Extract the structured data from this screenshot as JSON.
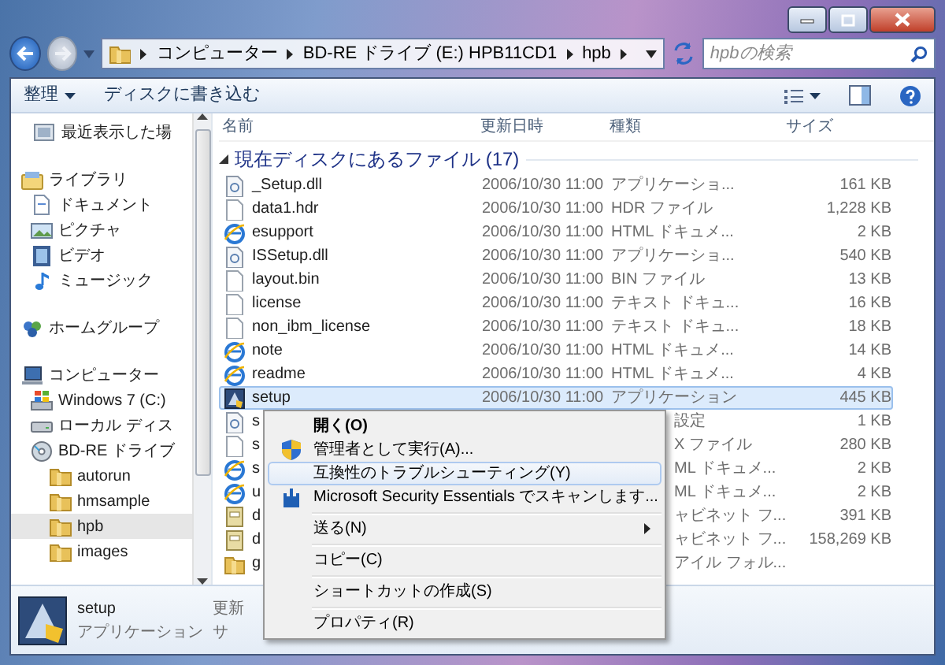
{
  "window": {
    "controls": [
      {
        "kind": "minimize"
      },
      {
        "kind": "maximize"
      },
      {
        "kind": "close"
      }
    ]
  },
  "address": {
    "segments": [
      "コンピューター",
      "BD-RE ドライブ (E:) HPB11CD1",
      "hpb"
    ]
  },
  "search": {
    "placeholder": "hpbの検索"
  },
  "toolbar": {
    "buttons": [
      {
        "label": "整理",
        "dropdown": true
      },
      {
        "label": "ディスクに書き込む",
        "dropdown": false
      }
    ]
  },
  "nav": {
    "sections": [
      {
        "items": [
          {
            "label": "最近表示した場",
            "kind": "recent",
            "selected": false
          }
        ]
      },
      {
        "items": [
          {
            "label": "ライブラリ",
            "kind": "library",
            "selected": false,
            "children": [
              {
                "label": "ドキュメント",
                "kind": "document",
                "selected": false
              },
              {
                "label": "ピクチャ",
                "kind": "picture",
                "selected": false
              },
              {
                "label": "ビデオ",
                "kind": "video",
                "selected": false
              },
              {
                "label": "ミュージック",
                "kind": "music",
                "selected": false
              }
            ]
          }
        ]
      },
      {
        "items": [
          {
            "label": "ホームグループ",
            "kind": "homegroup",
            "selected": false
          }
        ]
      },
      {
        "items": [
          {
            "label": "コンピューター",
            "kind": "computer",
            "selected": false,
            "children": [
              {
                "label": "Windows 7 (C:)",
                "kind": "windrive",
                "selected": false
              },
              {
                "label": "ローカル ディス",
                "kind": "disk",
                "selected": false
              },
              {
                "label": "BD-RE ドライブ",
                "kind": "bddrive",
                "selected": false,
                "children": [
                  {
                    "label": "autorun",
                    "kind": "folder",
                    "selected": false
                  },
                  {
                    "label": "hmsample",
                    "kind": "folder",
                    "selected": false
                  },
                  {
                    "label": "hpb",
                    "kind": "folder",
                    "selected": true
                  },
                  {
                    "label": "images",
                    "kind": "folder",
                    "selected": false
                  }
                ]
              }
            ]
          }
        ]
      }
    ]
  },
  "columns": [
    "名前",
    "更新日時",
    "種類",
    "サイズ"
  ],
  "group": {
    "title": "現在ディスクにあるファイル (17)"
  },
  "rows": [
    {
      "name": "_Setup.dll",
      "date": "2006/10/30 11:00",
      "type": "アプリケーショ...",
      "size": "161 KB",
      "kind": "dll",
      "selected": false
    },
    {
      "name": "data1.hdr",
      "date": "2006/10/30 11:00",
      "type": "HDR ファイル",
      "size": "1,228 KB",
      "kind": "file",
      "selected": false
    },
    {
      "name": "esupport",
      "date": "2006/10/30 11:00",
      "type": "HTML ドキュメ...",
      "size": "2 KB",
      "kind": "html",
      "selected": false
    },
    {
      "name": "ISSetup.dll",
      "date": "2006/10/30 11:00",
      "type": "アプリケーショ...",
      "size": "540 KB",
      "kind": "dll",
      "selected": false
    },
    {
      "name": "layout.bin",
      "date": "2006/10/30 11:00",
      "type": "BIN ファイル",
      "size": "13 KB",
      "kind": "file",
      "selected": false
    },
    {
      "name": "license",
      "date": "2006/10/30 11:00",
      "type": "テキスト ドキュ...",
      "size": "16 KB",
      "kind": "file",
      "selected": false
    },
    {
      "name": "non_ibm_license",
      "date": "2006/10/30 11:00",
      "type": "テキスト ドキュ...",
      "size": "18 KB",
      "kind": "file",
      "selected": false
    },
    {
      "name": "note",
      "date": "2006/10/30 11:00",
      "type": "HTML ドキュメ...",
      "size": "14 KB",
      "kind": "html",
      "selected": false
    },
    {
      "name": "readme",
      "date": "2006/10/30 11:00",
      "type": "HTML ドキュメ...",
      "size": "4 KB",
      "kind": "html",
      "selected": false
    },
    {
      "name": "setup",
      "date": "2006/10/30 11:00",
      "type": "アプリケーション",
      "size": "445 KB",
      "kind": "app",
      "selected": true
    },
    {
      "name": "s",
      "type": "設定",
      "size": "1 KB",
      "kind": "dll",
      "selected": false
    },
    {
      "name": "s",
      "type": "X ファイル",
      "size": "280 KB",
      "kind": "file",
      "selected": false
    },
    {
      "name": "s",
      "type": "ML ドキュメ...",
      "size": "2 KB",
      "kind": "html",
      "selected": false
    },
    {
      "name": "u",
      "type": "ML ドキュメ...",
      "size": "2 KB",
      "kind": "html",
      "selected": false
    },
    {
      "name": "d",
      "type": "ャビネット フ...",
      "size": "391 KB",
      "kind": "cab",
      "selected": false
    },
    {
      "name": "d",
      "type": "ャビネット フ...",
      "size": "158,269 KB",
      "kind": "cab",
      "selected": false
    },
    {
      "name": "g",
      "type": "アイル フォル...",
      "kind": "folder",
      "selected": false
    }
  ],
  "context_menu": {
    "groups": [
      [
        {
          "label": "開く(O)",
          "bold": true,
          "kind": "none",
          "submenu": false,
          "highlighted": false
        },
        {
          "label": "管理者として実行(A)...",
          "bold": false,
          "kind": "shield",
          "submenu": false,
          "highlighted": false
        },
        {
          "label": "互換性のトラブルシューティング(Y)",
          "bold": false,
          "kind": "none",
          "submenu": false,
          "highlighted": true
        },
        {
          "label": "Microsoft Security Essentials でスキャンします...",
          "bold": false,
          "kind": "castle",
          "submenu": false,
          "highlighted": false
        }
      ],
      [
        {
          "label": "送る(N)",
          "bold": false,
          "kind": "none",
          "submenu": true,
          "highlighted": false
        }
      ],
      [
        {
          "label": "コピー(C)",
          "bold": false,
          "kind": "none",
          "submenu": false,
          "highlighted": false
        }
      ],
      [
        {
          "label": "ショートカットの作成(S)",
          "bold": false,
          "kind": "none",
          "submenu": false,
          "highlighted": false
        }
      ],
      [
        {
          "label": "プロパティ(R)",
          "bold": false,
          "kind": "none",
          "submenu": false,
          "highlighted": false
        }
      ]
    ]
  },
  "details": {
    "name": "setup",
    "type": "アプリケーション",
    "labels": [
      "更新",
      "サ"
    ]
  }
}
